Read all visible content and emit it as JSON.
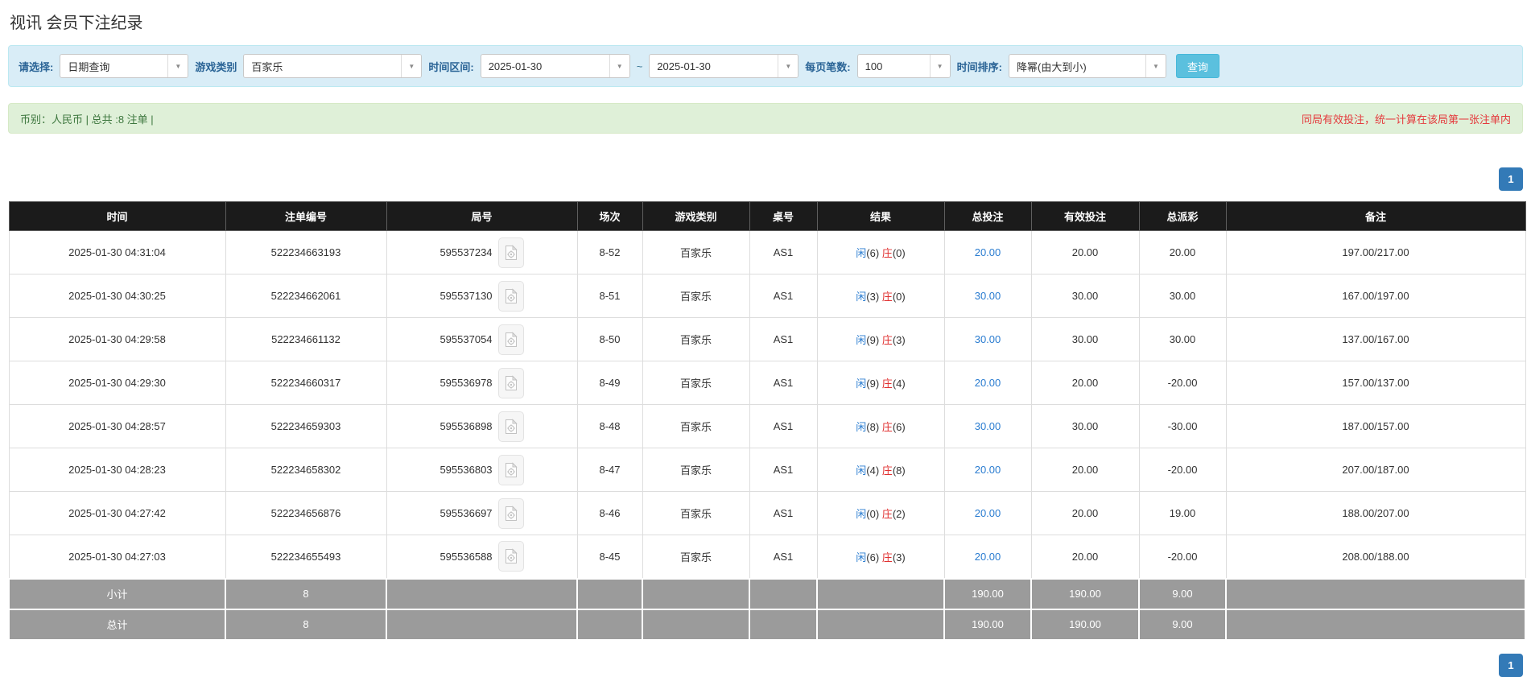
{
  "page": {
    "title": "视讯 会员下注纪录"
  },
  "colors": {
    "filter_bg": "#d9edf7",
    "filter_border": "#bce8f1",
    "label_blue": "#2a6496",
    "button_info": "#5bc0de",
    "button_info_border": "#46b8da",
    "summary_bg": "#dff0d8",
    "summary_border": "#d6e9c6",
    "summary_text": "#3c763d",
    "note_red": "#e4393c",
    "header_bg": "#1b1b1b",
    "footer_bg": "#9b9b9b",
    "link_blue": "#2a7cd0",
    "negative_red": "#e03131",
    "pager_blue": "#337ab7"
  },
  "filters": {
    "query_type": {
      "label": "请选择:",
      "value": "日期查询"
    },
    "game_category": {
      "label": "游戏类别",
      "value": "百家乐"
    },
    "time_range": {
      "label": "时间区间:",
      "from": "2025-01-30",
      "to": "2025-01-30",
      "separator": "~"
    },
    "page_size": {
      "label": "每页笔数:",
      "value": "100"
    },
    "sort": {
      "label": "时间排序:",
      "value": "降幂(由大到小)"
    },
    "search_button": "查询"
  },
  "summary": {
    "left": "币别：人民币 | 总共 :8 注单 |",
    "right": "同局有效投注，统一计算在该局第一张注单内"
  },
  "pagination": {
    "page": "1"
  },
  "table": {
    "headers": [
      "时间",
      "注单编号",
      "局号",
      "场次",
      "游戏类别",
      "桌号",
      "结果",
      "总投注",
      "有效投注",
      "总派彩",
      "备注"
    ],
    "result_labels": {
      "player": "闲",
      "banker": "庄"
    },
    "rows": [
      {
        "time": "2025-01-30 04:31:04",
        "bet_id": "522234663193",
        "round_id": "595537234",
        "session": "8-52",
        "game": "百家乐",
        "table_no": "AS1",
        "result": {
          "player": "6",
          "banker": "0"
        },
        "total_bet": "20.00",
        "valid_bet": "20.00",
        "payout": "20.00",
        "remark": "197.00/217.00"
      },
      {
        "time": "2025-01-30 04:30:25",
        "bet_id": "522234662061",
        "round_id": "595537130",
        "session": "8-51",
        "game": "百家乐",
        "table_no": "AS1",
        "result": {
          "player": "3",
          "banker": "0"
        },
        "total_bet": "30.00",
        "valid_bet": "30.00",
        "payout": "30.00",
        "remark": "167.00/197.00"
      },
      {
        "time": "2025-01-30 04:29:58",
        "bet_id": "522234661132",
        "round_id": "595537054",
        "session": "8-50",
        "game": "百家乐",
        "table_no": "AS1",
        "result": {
          "player": "9",
          "banker": "3"
        },
        "total_bet": "30.00",
        "valid_bet": "30.00",
        "payout": "30.00",
        "remark": "137.00/167.00"
      },
      {
        "time": "2025-01-30 04:29:30",
        "bet_id": "522234660317",
        "round_id": "595536978",
        "session": "8-49",
        "game": "百家乐",
        "table_no": "AS1",
        "result": {
          "player": "9",
          "banker": "4"
        },
        "total_bet": "20.00",
        "valid_bet": "20.00",
        "payout": "-20.00",
        "remark": "157.00/137.00"
      },
      {
        "time": "2025-01-30 04:28:57",
        "bet_id": "522234659303",
        "round_id": "595536898",
        "session": "8-48",
        "game": "百家乐",
        "table_no": "AS1",
        "result": {
          "player": "8",
          "banker": "6"
        },
        "total_bet": "30.00",
        "valid_bet": "30.00",
        "payout": "-30.00",
        "remark": "187.00/157.00"
      },
      {
        "time": "2025-01-30 04:28:23",
        "bet_id": "522234658302",
        "round_id": "595536803",
        "session": "8-47",
        "game": "百家乐",
        "table_no": "AS1",
        "result": {
          "player": "4",
          "banker": "8"
        },
        "total_bet": "20.00",
        "valid_bet": "20.00",
        "payout": "-20.00",
        "remark": "207.00/187.00"
      },
      {
        "time": "2025-01-30 04:27:42",
        "bet_id": "522234656876",
        "round_id": "595536697",
        "session": "8-46",
        "game": "百家乐",
        "table_no": "AS1",
        "result": {
          "player": "0",
          "banker": "2"
        },
        "total_bet": "20.00",
        "valid_bet": "20.00",
        "payout": "19.00",
        "remark": "188.00/207.00"
      },
      {
        "time": "2025-01-30 04:27:03",
        "bet_id": "522234655493",
        "round_id": "595536588",
        "session": "8-45",
        "game": "百家乐",
        "table_no": "AS1",
        "result": {
          "player": "6",
          "banker": "3"
        },
        "total_bet": "20.00",
        "valid_bet": "20.00",
        "payout": "-20.00",
        "remark": "208.00/188.00"
      }
    ],
    "subtotal": {
      "label": "小计",
      "count": "8",
      "total_bet": "190.00",
      "valid_bet": "190.00",
      "payout": "9.00"
    },
    "total": {
      "label": "总计",
      "count": "8",
      "total_bet": "190.00",
      "valid_bet": "190.00",
      "payout": "9.00"
    }
  }
}
